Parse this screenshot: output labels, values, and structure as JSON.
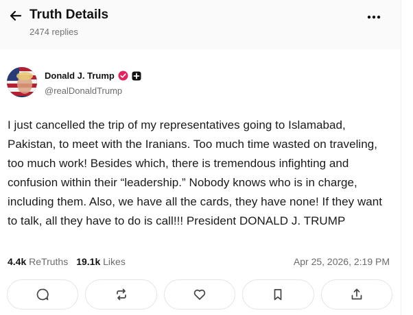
{
  "header": {
    "title": "Truth Details",
    "replies": "2474 replies",
    "back_icon": "arrow-left-icon",
    "more_icon": "more-dots-icon"
  },
  "post": {
    "author": {
      "name": "Donald J. Trump",
      "handle": "@realDonaldTrump",
      "verified_icon": "verified-badge-icon",
      "plus_icon": "plus-badge-icon",
      "verified_color": "#e0245e"
    },
    "text": "I just cancelled the trip of my representatives going to Islamabad, Pakistan, to meet with the Iranians. Too much time wasted on traveling, too much work! Besides which, there is tremendous infighting and confusion within their “leadership.” Nobody knows who is in charge, including them. Also, we have all the cards, they have none! If they want to talk, all they have to do is call!!! President DONALD J. TRUMP",
    "retruths_count": "4.4k",
    "retruths_label": "ReTruths",
    "likes_count": "19.1k",
    "likes_label": "Likes",
    "timestamp": "Apr 25, 2026, 2:19 PM"
  },
  "actions": [
    {
      "name": "reply",
      "icon": "comment-icon"
    },
    {
      "name": "retruth",
      "icon": "retruth-icon"
    },
    {
      "name": "like",
      "icon": "heart-icon"
    },
    {
      "name": "bookmark",
      "icon": "bookmark-icon"
    },
    {
      "name": "share",
      "icon": "share-icon"
    }
  ]
}
